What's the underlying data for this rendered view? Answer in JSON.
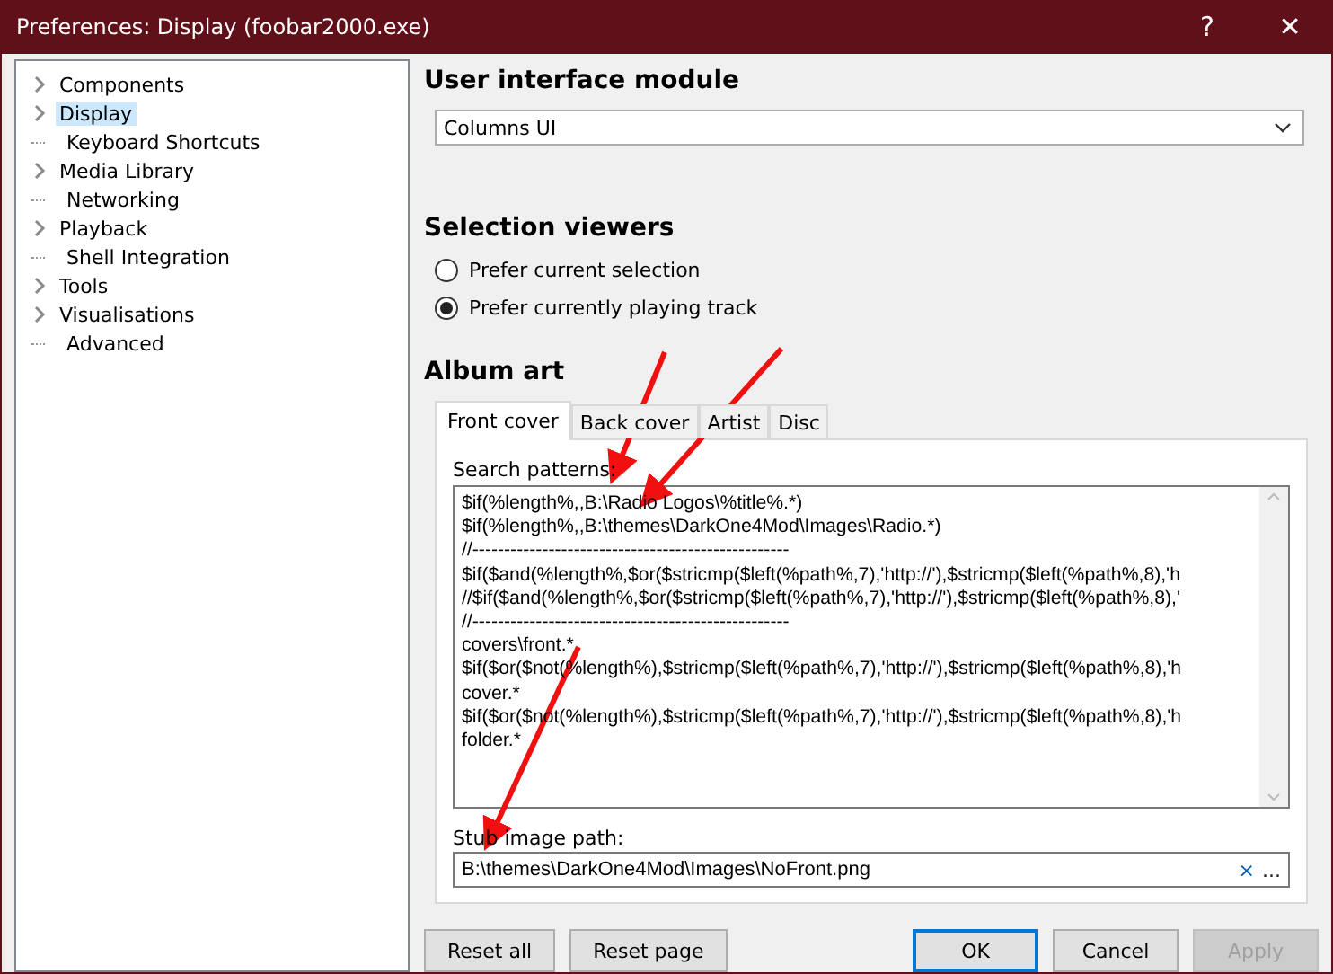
{
  "window": {
    "title": "Preferences: Display (foobar2000.exe)",
    "help_button": "?",
    "close_button": "✕"
  },
  "tree": [
    {
      "label": "Components",
      "kind": "expandable",
      "selected": false
    },
    {
      "label": "Display",
      "kind": "expandable",
      "selected": true
    },
    {
      "label": "Keyboard Shortcuts",
      "kind": "leaf",
      "selected": false
    },
    {
      "label": "Media Library",
      "kind": "expandable",
      "selected": false
    },
    {
      "label": "Networking",
      "kind": "leaf",
      "selected": false
    },
    {
      "label": "Playback",
      "kind": "expandable",
      "selected": false
    },
    {
      "label": "Shell Integration",
      "kind": "leaf",
      "selected": false
    },
    {
      "label": "Tools",
      "kind": "expandable",
      "selected": false
    },
    {
      "label": "Visualisations",
      "kind": "expandable",
      "selected": false
    },
    {
      "label": "Advanced",
      "kind": "leaf",
      "selected": false
    }
  ],
  "ui_module": {
    "heading": "User interface module",
    "value": "Columns UI"
  },
  "selection_viewers": {
    "heading": "Selection viewers",
    "options": [
      {
        "label": "Prefer current selection",
        "selected": false
      },
      {
        "label": "Prefer currently playing track",
        "selected": true
      }
    ]
  },
  "album_art": {
    "heading": "Album art",
    "tabs": [
      {
        "label": "Front cover",
        "selected": true
      },
      {
        "label": "Back cover",
        "selected": false
      },
      {
        "label": "Artist",
        "selected": false
      },
      {
        "label": "Disc",
        "selected": false
      }
    ],
    "search_patterns_label": "Search patterns:",
    "search_patterns": [
      "$if(%length%,,B:\\Radio Logos\\%title%.*)",
      "$if(%length%,,B:\\themes\\DarkOne4Mod\\Images\\Radio.*)",
      "//--------------------------------------------------",
      "$if($and(%length%,$or($stricmp($left(%path%,7),'http://'),$stricmp($left(%path%,8),'h",
      "//$if($and(%length%,$or($stricmp($left(%path%,7),'http://'),$stricmp($left(%path%,8),'",
      "//--------------------------------------------------",
      "covers\\front.*",
      "$if($or($not(%length%),$stricmp($left(%path%,7),'http://'),$stricmp($left(%path%,8),'h",
      "cover.*",
      "$if($or($not(%length%),$stricmp($left(%path%,7),'http://'),$stricmp($left(%path%,8),'h",
      "folder.*"
    ],
    "stub_label": "Stub image path:",
    "stub_path": "B:\\themes\\DarkOne4Mod\\Images\\NoFront.png",
    "clear_button": "×",
    "browse_button": "..."
  },
  "buttons": [
    {
      "label": "Reset all",
      "kind": "normal"
    },
    {
      "label": "Reset page",
      "kind": "normal"
    },
    {
      "label": "OK",
      "kind": "default"
    },
    {
      "label": "Cancel",
      "kind": "normal"
    },
    {
      "label": "Apply",
      "kind": "disabled"
    }
  ]
}
